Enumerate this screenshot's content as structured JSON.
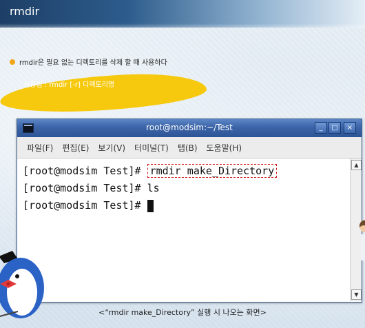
{
  "slide": {
    "title": "rmdir",
    "bullet": "rmdir은 필요 없는 디렉토리를 삭제 할 때 사용하다",
    "usage": "사용법 : rmdir  [-r]  디렉토리명",
    "caption": "<“rmdir  make_Directory” 실행 시 나오는 화면>"
  },
  "window": {
    "title": "root@modsim:~/Test",
    "controls": {
      "minimize": "_",
      "maximize": "□",
      "close": "×"
    },
    "menu": [
      "파일(F)",
      "편집(E)",
      "보기(V)",
      "터미널(T)",
      "탭(B)",
      "도움말(H)"
    ]
  },
  "terminal": {
    "prompt": "[root@modsim Test]# ",
    "lines": [
      {
        "prompt": "[root@modsim Test]# ",
        "command": "rmdir make_Directory"
      },
      {
        "prompt": "[root@modsim Test]# ",
        "command": "ls"
      },
      {
        "prompt": "[root@modsim Test]# ",
        "command": ""
      }
    ]
  },
  "colors": {
    "accent": "#f2a51a",
    "highlight": "#f6c90e",
    "titlebar": "#3b64a8",
    "annotation": "#d21a1a"
  },
  "icons": {
    "window": "terminal-icon",
    "scroll_up": "scroll-up-arrow-icon",
    "scroll_down": "scroll-down-arrow-icon",
    "mascot": "penguin-mascot-icon"
  }
}
